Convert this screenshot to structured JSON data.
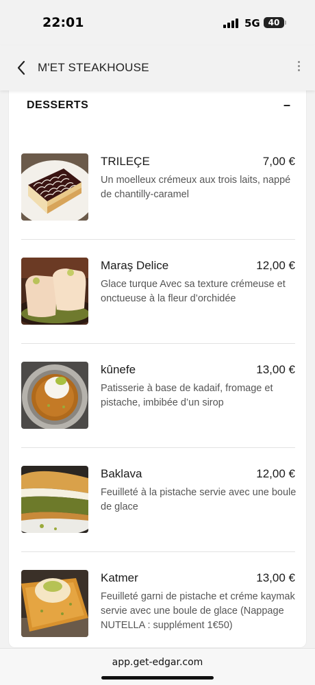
{
  "status_bar": {
    "time": "22:01",
    "network": "5G",
    "battery": "40"
  },
  "header": {
    "title": "M'ET STEAKHOUSE"
  },
  "section": {
    "title": "DESSERTS",
    "toggle": "–"
  },
  "items": [
    {
      "name": "TRILEÇE",
      "price": "7,00 €",
      "description": "Un moelleux crémeux aux trois laits, nappé de chantilly-caramel",
      "image": "trilece-image"
    },
    {
      "name": "Maraş Delice",
      "price": "12,00 €",
      "description": "Glace turque Avec sa texture crémeuse et onctueuse à la fleur d’orchidée",
      "image": "maras-delice-image"
    },
    {
      "name": "kûnefe",
      "price": "13,00 €",
      "description": "Patisserie à base de kadaif, fromage et pistache, imbibée d’un sirop",
      "image": "kunefe-image"
    },
    {
      "name": "Baklava",
      "price": "12,00 €",
      "description": "Feuilleté à la pistache servie avec une boule de glace",
      "image": "baklava-image"
    },
    {
      "name": "Katmer",
      "price": "13,00 €",
      "description": "Feuilleté garni de pistache et créme kaymak servie avec une boule de glace (Nappage NUTELLA : supplément 1€50)",
      "image": "katmer-image"
    }
  ],
  "footer": {
    "url": "app.get-edgar.com"
  }
}
